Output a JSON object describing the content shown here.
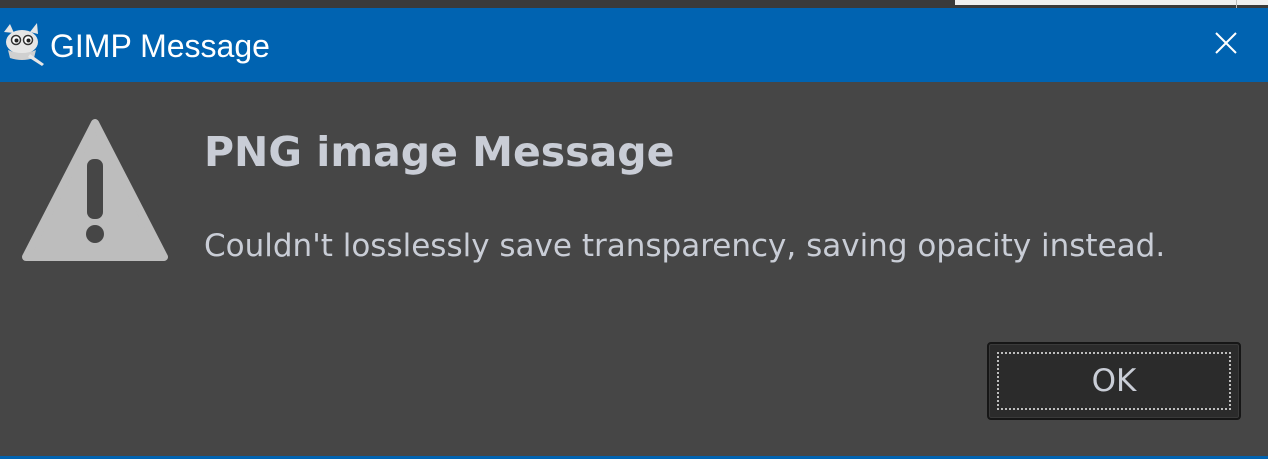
{
  "window": {
    "title": "GIMP Message",
    "app_icon": "gimp-wilber-icon",
    "close_icon": "close-icon",
    "titlebar_color": "#0063b1"
  },
  "dialog": {
    "status_icon": "warning-icon",
    "heading": "PNG image Message",
    "message": "Couldn't losslessly save transparency, saving opacity instead.",
    "ok_label": "OK",
    "background_color": "#464646",
    "text_color": "#c9cdd6"
  }
}
